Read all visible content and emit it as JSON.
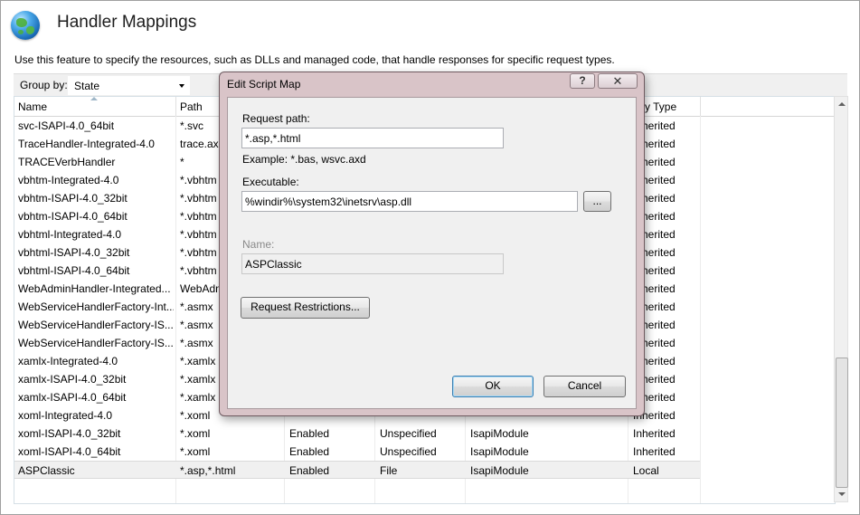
{
  "header": {
    "title": "Handler Mappings",
    "description": "Use this feature to specify the resources, such as DLLs and managed code, that handle responses for specific request types."
  },
  "toolbar": {
    "group_by_label": "Group by:",
    "group_by_value": "State"
  },
  "grid": {
    "columns": [
      "Name",
      "Path",
      "",
      "",
      "",
      "ntry Type"
    ],
    "rows": [
      [
        "svc-ISAPI-4.0_64bit",
        "*.svc",
        "",
        "",
        "",
        "Inherited"
      ],
      [
        "TraceHandler-Integrated-4.0",
        "trace.axd",
        "",
        "",
        "",
        "Inherited"
      ],
      [
        "TRACEVerbHandler",
        "*",
        "",
        "",
        "",
        "Inherited"
      ],
      [
        "vbhtm-Integrated-4.0",
        "*.vbhtm",
        "",
        "",
        "",
        "Inherited"
      ],
      [
        "vbhtm-ISAPI-4.0_32bit",
        "*.vbhtm",
        "",
        "",
        "",
        "Inherited"
      ],
      [
        "vbhtm-ISAPI-4.0_64bit",
        "*.vbhtm",
        "",
        "",
        "",
        "Inherited"
      ],
      [
        "vbhtml-Integrated-4.0",
        "*.vbhtm",
        "",
        "",
        "",
        "Inherited"
      ],
      [
        "vbhtml-ISAPI-4.0_32bit",
        "*.vbhtm",
        "",
        "",
        "",
        "Inherited"
      ],
      [
        "vbhtml-ISAPI-4.0_64bit",
        "*.vbhtm",
        "",
        "",
        "",
        "Inherited"
      ],
      [
        "WebAdminHandler-Integrated...",
        "WebAdmi",
        "",
        "",
        "",
        "Inherited"
      ],
      [
        "WebServiceHandlerFactory-Int...",
        "*.asmx",
        "",
        "",
        "",
        "Inherited"
      ],
      [
        "WebServiceHandlerFactory-IS...",
        "*.asmx",
        "",
        "",
        "",
        "Inherited"
      ],
      [
        "WebServiceHandlerFactory-IS...",
        "*.asmx",
        "",
        "",
        "",
        "Inherited"
      ],
      [
        "xamlx-Integrated-4.0",
        "*.xamlx",
        "",
        "",
        "",
        "Inherited"
      ],
      [
        "xamlx-ISAPI-4.0_32bit",
        "*.xamlx",
        "",
        "",
        "",
        "Inherited"
      ],
      [
        "xamlx-ISAPI-4.0_64bit",
        "*.xamlx",
        "",
        "",
        "",
        "Inherited"
      ],
      [
        "xoml-Integrated-4.0",
        "*.xoml",
        "",
        "",
        "",
        "Inherited"
      ],
      [
        "xoml-ISAPI-4.0_32bit",
        "*.xoml",
        "Enabled",
        "Unspecified",
        "IsapiModule",
        "Inherited"
      ],
      [
        "xoml-ISAPI-4.0_64bit",
        "*.xoml",
        "Enabled",
        "Unspecified",
        "IsapiModule",
        "Inherited"
      ],
      [
        "ASPClassic",
        "*.asp,*.html",
        "Enabled",
        "File",
        "IsapiModule",
        "Local"
      ]
    ],
    "selected_row": 19
  },
  "dialog": {
    "title": "Edit Script Map",
    "help_label": "?",
    "close_label": "✕",
    "request_path_label": "Request path:",
    "request_path_value": "*.asp,*.html",
    "example_text": "Example: *.bas, wsvc.axd",
    "executable_label": "Executable:",
    "executable_value": "%windir%\\system32\\inetsrv\\asp.dll",
    "browse_label": "...",
    "name_label": "Name:",
    "name_value": "ASPClassic",
    "restrictions_label": "Request Restrictions...",
    "ok_label": "OK",
    "cancel_label": "Cancel"
  }
}
